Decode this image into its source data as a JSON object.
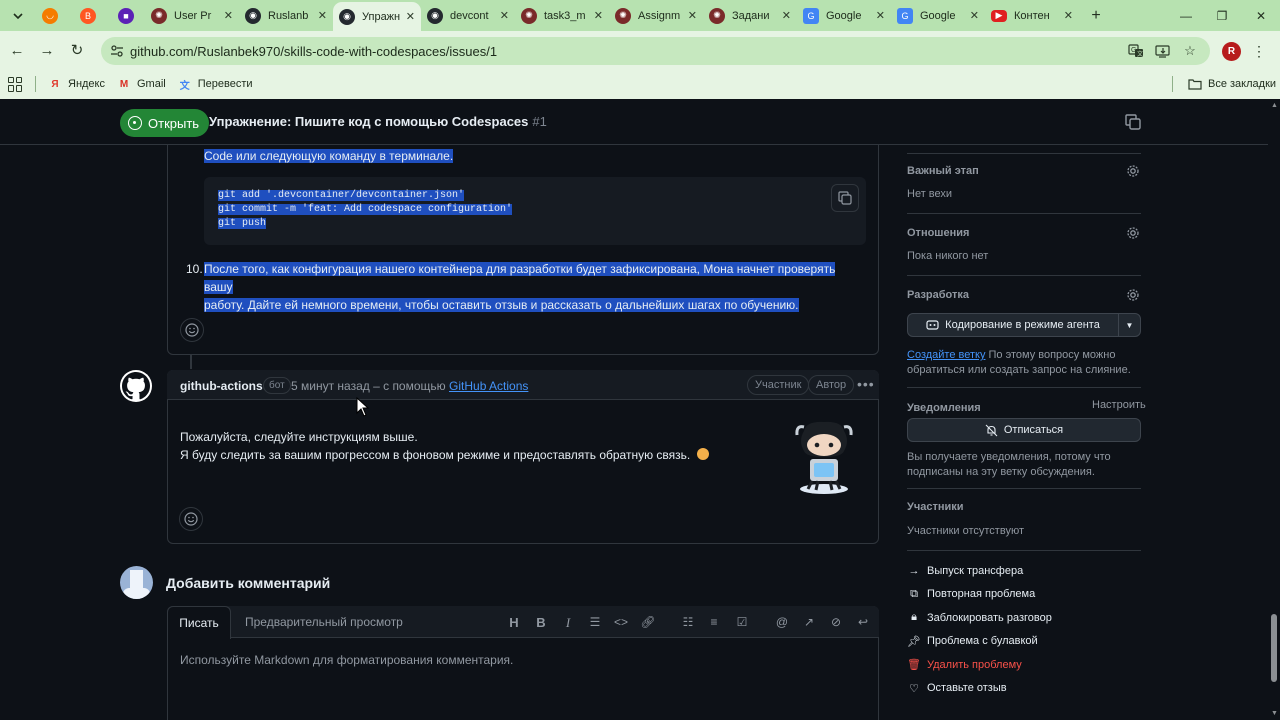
{
  "browser": {
    "tabs": [
      {
        "label": "",
        "icon": "orange-swirl-icon",
        "color": "#f57c00",
        "pinned": true
      },
      {
        "label": "",
        "icon": "blogger-icon",
        "color": "#ff5722",
        "pinned": true
      },
      {
        "label": "",
        "icon": "purple-square-icon",
        "color": "#5b21b6",
        "pinned": true
      },
      {
        "label": "User Pr",
        "icon": "openai-icon",
        "color": "#7a2a2a"
      },
      {
        "label": "Ruslanb",
        "icon": "github-icon",
        "color": "#24292f"
      },
      {
        "label": "Упражн",
        "icon": "github-icon",
        "color": "#24292f",
        "active": true
      },
      {
        "label": "devcont",
        "icon": "github-icon",
        "color": "#24292f"
      },
      {
        "label": "task3_m",
        "icon": "openai-icon",
        "color": "#7a2a2a"
      },
      {
        "label": "Assignm",
        "icon": "openai-icon",
        "color": "#7a2a2a"
      },
      {
        "label": "Задани",
        "icon": "openai-icon",
        "color": "#7a2a2a"
      },
      {
        "label": "Google",
        "icon": "google-translate-icon",
        "color": "#4285f4"
      },
      {
        "label": "Google",
        "icon": "google-translate-icon",
        "color": "#4285f4"
      },
      {
        "label": "Контен",
        "icon": "youtube-icon",
        "color": "#e02020"
      }
    ],
    "url": "github.com/Ruslanbek970/skills-code-with-codespaces/issues/1",
    "bookmarks": [
      {
        "label": "Яндекс",
        "icon": "yandex-icon",
        "color": "#e03a2e"
      },
      {
        "label": "Gmail",
        "icon": "gmail-icon",
        "color": "#d93025"
      },
      {
        "label": "Перевести",
        "icon": "translate-icon",
        "color": "#4285f4"
      }
    ],
    "all_bookmarks": "Все закладки",
    "profile_initial": "R"
  },
  "header": {
    "state": "Открыть",
    "title": "Упражнение: Пишите код с помощью Codespaces",
    "number": "#1"
  },
  "step9": {
    "text_end": "Code или следующую команду в терминале.",
    "code": [
      "git add '.devcontainer/devcontainer.json'",
      "git commit -m 'feat: Add codespace configuration'",
      "git push"
    ]
  },
  "step10": {
    "number": "10.",
    "line1": "После того, как конфигурация нашего контейнера для разработки будет зафиксирована, Мона начнет проверять вашу",
    "line2": "работу. Дайте ей немного времени, чтобы оставить отзыв и рассказать о дальнейших шагах по обучению."
  },
  "comment2": {
    "author": "github-actions",
    "bot_label": "бот",
    "time": "5 минут назад – с помощью",
    "via": "GitHub Actions",
    "role1": "Участник",
    "role2": "Автор",
    "line1": "Пожалуйста, следуйте инструкциям выше.",
    "line2": "Я буду следить за вашим прогрессом в фоновом режиме и предоставлять обратную связь."
  },
  "add_comment": {
    "title": "Добавить комментарий",
    "tab_write": "Писать",
    "tab_preview": "Предварительный просмотр",
    "placeholder": "Используйте Markdown для форматирования комментария."
  },
  "sidebar": {
    "milestone_title": "Важный этап",
    "milestone_value": "Нет вехи",
    "relations_title": "Отношения",
    "relations_value": "Пока никого нет",
    "dev_title": "Разработка",
    "agent_button": "Кодирование в режиме агента",
    "create_branch": "Создайте ветку",
    "dev_text_1": " По этому вопросу можно",
    "dev_text_2": "обратиться или создать запрос на слияние.",
    "notif_title": "Уведомления",
    "notif_customize": "Настроить",
    "unsubscribe": "Отписаться",
    "notif_text_1": "Вы получаете уведомления, потому что",
    "notif_text_2": "подписаны на эту ветку обсуждения.",
    "participants_title": "Участники",
    "participants_value": "Участники отсутствуют",
    "actions": [
      {
        "label": "Выпуск трансфера",
        "icon": "arrow-right-icon"
      },
      {
        "label": "Повторная проблема",
        "icon": "duplicate-icon"
      },
      {
        "label": "Заблокировать разговор",
        "icon": "lock-icon"
      },
      {
        "label": "Проблема с булавкой",
        "icon": "pin-icon"
      },
      {
        "label": "Удалить проблему",
        "icon": "trash-icon",
        "color": "#f85149"
      },
      {
        "label": "Оставьте отзыв",
        "icon": "heart-icon"
      }
    ]
  },
  "colors": {
    "chrome_accent": "#b7e2b0",
    "open_badge": "#238636",
    "selection": "#1f4fbf",
    "link": "#4493f8",
    "danger": "#f85149"
  }
}
